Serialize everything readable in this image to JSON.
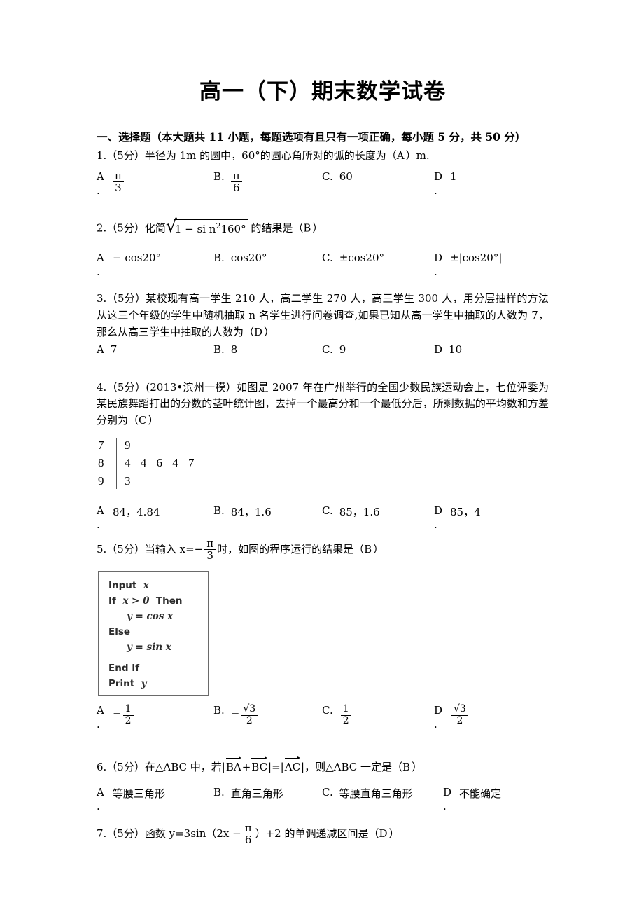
{
  "document": {
    "title": "高一（下）期末数学试卷",
    "section_header": "一、选择题（本大题共 11 小题，每题选项有且只有一项正确，每小题 5 分，共 50 分）"
  },
  "questions": [
    {
      "number": "1",
      "marks": "（5分）",
      "stem_pre": "1.（5分）半径为 1m 的圆中，60°的圆心角所对的弧的长度为（",
      "answer": "A",
      "stem_post": "）m.",
      "options": [
        {
          "label": "A",
          "dot": ".",
          "num": "π",
          "den": "3",
          "kind": "frac"
        },
        {
          "label": "B.",
          "dot": "",
          "num": "π",
          "den": "6",
          "kind": "frac"
        },
        {
          "label": "C.",
          "dot": "",
          "text": "60",
          "kind": "text"
        },
        {
          "label": "D",
          "dot": ".",
          "text": "1",
          "kind": "text"
        }
      ]
    },
    {
      "number": "2",
      "stem_pre": "2.（5分）化简",
      "radicand_a": "1 − si n",
      "radicand_exp": "2",
      "radicand_b": "160°",
      "stem_mid": "的结果是（",
      "answer": "B",
      "stem_post": "）",
      "options": [
        {
          "label": "A",
          "dot": ".",
          "text": "− cos20°",
          "kind": "text"
        },
        {
          "label": "B.",
          "dot": "",
          "text": "cos20°",
          "kind": "text"
        },
        {
          "label": "C.",
          "dot": "",
          "text": "±cos20°",
          "kind": "text"
        },
        {
          "label": "D",
          "dot": ".",
          "text": "±|cos20°|",
          "kind": "text"
        }
      ]
    },
    {
      "number": "3",
      "stem_pre": "3.（5分）某校现有高一学生 210 人，高二学生 270 人，高三学生 300 人，用分层抽样的方法从这三个年级的学生中随机抽取 n 名学生进行问卷调查,如果已知从高一学生中抽取的人数为 7，那么从高三学生中抽取的人数为（",
      "answer": "D",
      "stem_post": "）",
      "options": [
        {
          "label": "A",
          "dot": "",
          "text": "7",
          "kind": "text"
        },
        {
          "label": "B.",
          "dot": "",
          "text": "8",
          "kind": "text"
        },
        {
          "label": "C.",
          "dot": "",
          "text": "9",
          "kind": "text"
        },
        {
          "label": "D",
          "dot": "",
          "text": "10",
          "kind": "text"
        }
      ]
    },
    {
      "number": "4",
      "stem_pre": "4.（5分）(2013•滨州一模）如图是 2007 年在广州举行的全国少数民族运动会上，七位评委为某民族舞蹈打出的分数的茎叶统计图，去掉一个最高分和一个最低分后，所剩数据的平均数和方差分别为（",
      "answer": "C",
      "stem_post": "）",
      "options": [
        {
          "label": "A",
          "dot": ".",
          "text": "84，4.84",
          "kind": "text"
        },
        {
          "label": "B.",
          "dot": "",
          "text": "84，1.6",
          "kind": "text"
        },
        {
          "label": "C.",
          "dot": "",
          "text": "85，1.6",
          "kind": "text"
        },
        {
          "label": "D",
          "dot": ".",
          "text": "85，4",
          "kind": "text"
        }
      ]
    },
    {
      "number": "5",
      "stem_pre": "5.（5分）当输入 x=",
      "minus": "−",
      "frac_num": "π",
      "frac_den": "3",
      "stem_mid": "时，如图的程序运行的结果是（",
      "answer": "B",
      "stem_post": "）",
      "options": [
        {
          "label": "A",
          "dot": ".",
          "sign": "−",
          "num": "1",
          "den": "2",
          "kind": "frac"
        },
        {
          "label": "B.",
          "dot": "",
          "sign": "−",
          "num": "√3",
          "den": "2",
          "kind": "sqrtfrac"
        },
        {
          "label": "C.",
          "dot": "",
          "sign": "",
          "num": "1",
          "den": "2",
          "kind": "frac"
        },
        {
          "label": "D",
          "dot": ".",
          "sign": "",
          "num": "√3",
          "den": "2",
          "kind": "sqrtfrac"
        }
      ]
    },
    {
      "number": "6",
      "stem_pre": "6.（5分）在△ABC 中，若|",
      "vec1": "BA",
      "plus": "+",
      "vec2": "BC",
      "eq": "|=|",
      "vec3": "AC",
      "stem_mid": "|，则△ABC 一定是（",
      "answer": "B",
      "stem_post": "）",
      "options": [
        {
          "label": "A",
          "dot": ".",
          "text": "等腰三角形",
          "kind": "text"
        },
        {
          "label": "B.",
          "dot": "",
          "text": "直角三角形",
          "kind": "text"
        },
        {
          "label": "C.",
          "dot": "",
          "text": "等腰直角三角形",
          "kind": "text"
        },
        {
          "label": "D",
          "dot": ".",
          "text": "不能确定",
          "kind": "text"
        }
      ]
    },
    {
      "number": "7",
      "stem_pre": "7.（5分）函数 y=3sin（2x",
      "minus": "−",
      "frac_num": "π",
      "frac_den": "6",
      "stem_mid": "）+2 的单调递减区间是（",
      "answer": "D",
      "stem_post": "）"
    }
  ],
  "stem_leaf": {
    "rows": [
      {
        "stem": "7",
        "leaves": "9"
      },
      {
        "stem": "8",
        "leaves": "4 4 6 4 7"
      },
      {
        "stem": "9",
        "leaves": "3"
      }
    ]
  },
  "program_box": {
    "lines": [
      {
        "text": "Input",
        "ital": "x",
        "indent": false
      },
      {
        "text": "If",
        "ital": "x > 0",
        "tail": "Then",
        "indent": false
      },
      {
        "ital": "y = cos x",
        "indent": true
      },
      {
        "text": "Else",
        "indent": false
      },
      {
        "ital": "y = sin x",
        "indent": true
      },
      {
        "text": "End If",
        "indent": false
      },
      {
        "text": "Print",
        "ital": "y",
        "indent": false
      }
    ]
  }
}
